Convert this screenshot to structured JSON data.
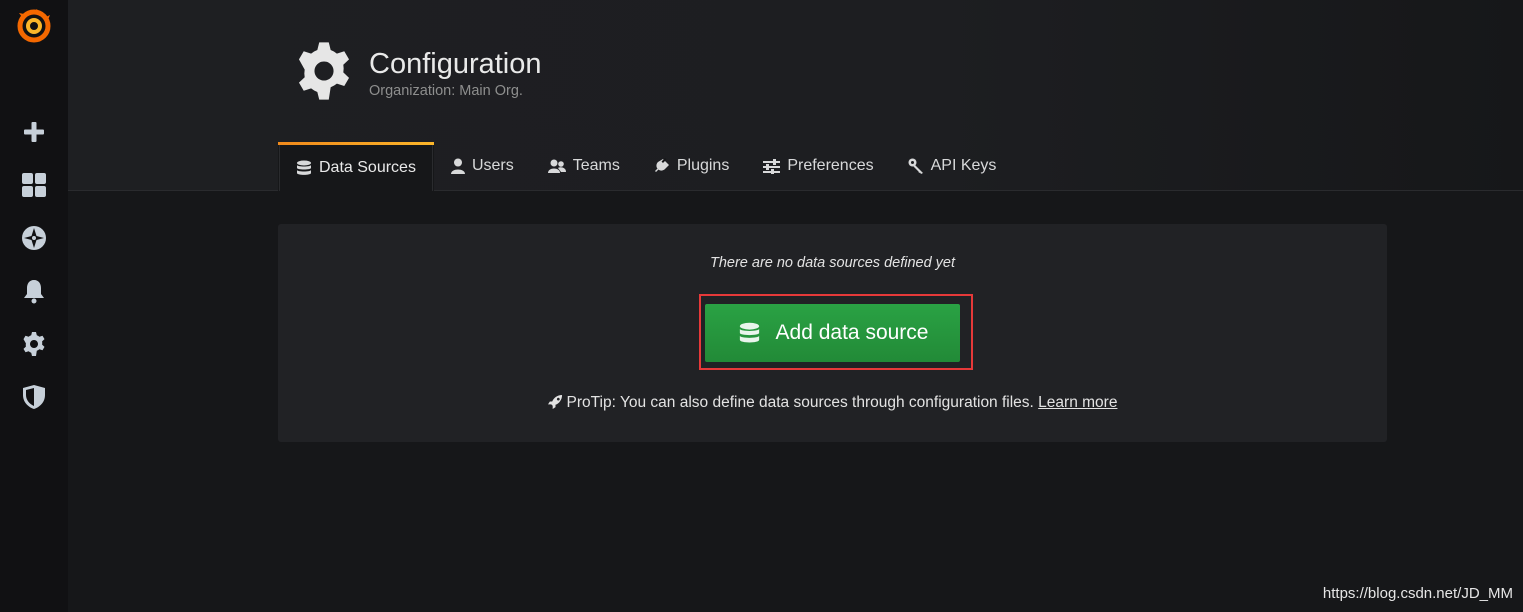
{
  "sidemenu": {
    "logo": "grafana-logo-icon",
    "items": [
      {
        "icon": "plus-icon",
        "name": "create"
      },
      {
        "icon": "dashboards-grid-icon",
        "name": "dashboards"
      },
      {
        "icon": "explore-compass-icon",
        "name": "explore"
      },
      {
        "icon": "bell-icon",
        "name": "alerting"
      },
      {
        "icon": "gear-icon",
        "name": "configuration"
      },
      {
        "icon": "shield-icon",
        "name": "server-admin"
      }
    ]
  },
  "header": {
    "icon": "gear-icon",
    "title": "Configuration",
    "subtitle": "Organization: Main Org."
  },
  "tabs": [
    {
      "label": "Data Sources",
      "icon": "database-icon",
      "active": true
    },
    {
      "label": "Users",
      "icon": "user-icon"
    },
    {
      "label": "Teams",
      "icon": "users-icon"
    },
    {
      "label": "Plugins",
      "icon": "plug-icon"
    },
    {
      "label": "Preferences",
      "icon": "sliders-icon"
    },
    {
      "label": "API Keys",
      "icon": "key-icon"
    }
  ],
  "empty_state": {
    "message": "There are no data sources defined yet",
    "button_label": "Add data source",
    "button_icon": "database-icon",
    "protip_icon": "rocket-icon",
    "protip_text": "ProTip: You can also define data sources through configuration files. ",
    "protip_link": "Learn more"
  },
  "watermark": "https://blog.csdn.net/JD_MM",
  "colors": {
    "accent_orange": "#f0891b",
    "button_green": "#2aa244",
    "highlight_red": "#e63939",
    "background": "#161719"
  }
}
